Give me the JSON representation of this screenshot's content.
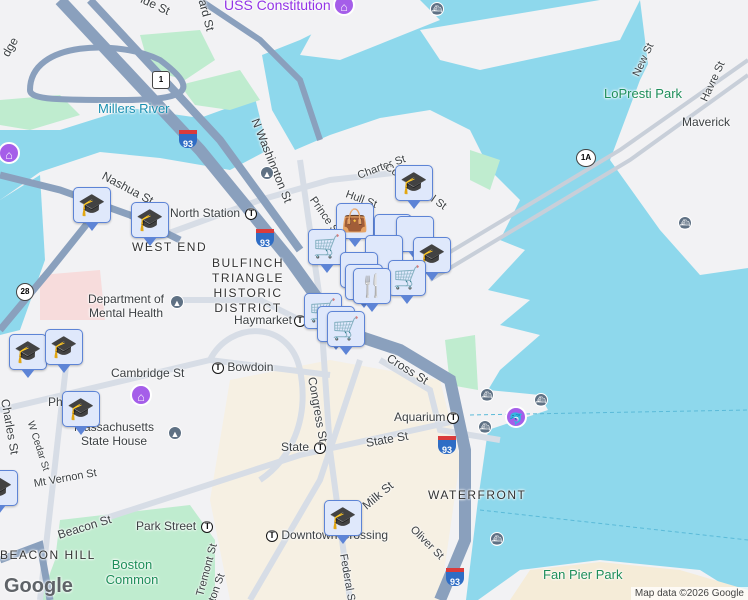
{
  "map": {
    "colors": {
      "water": "#8ed8ec",
      "land": "#f2f2f4",
      "park": "#bfeccf",
      "highway": "#8aa0bd",
      "road": "#d7dde6",
      "marker_bg": "#dfe8fb",
      "marker_border": "#5d84d6",
      "poi": "#9334e6"
    },
    "labels": {
      "uss_constitution": "USS Constitution",
      "millers_river": "Millers River",
      "n_washington_st": "N Washington St",
      "nashua_st": "Nashua St",
      "station": "North Station",
      "west_end": "WEST END",
      "bulfinch": "BULFINCH TRIANGLE HISTORIC DISTRICT",
      "dept_mental_health": "Department of Mental Health",
      "haymarket": "Haymarket",
      "cambridge_st": "Cambridge St",
      "bowdoin": "Bowdoin",
      "charles_st": "Charles St",
      "w_cedar_st": "W Cedar St",
      "ma_state_house": "Massachusetts State House",
      "mt_vernon_st": "Mt Vernon St",
      "beacon_st": "Beacon St",
      "park_street": "Park Street",
      "beacon_hill": "BEACON HILL",
      "boston_common": "Boston Common",
      "congress_st": "Congress St",
      "state": "State",
      "state_st": "State St",
      "downtown_crossing": "Downtown Crossing",
      "federal_st": "Federal St",
      "milk_st": "Milk St",
      "oliver_st": "Oliver St",
      "waterfront": "WATERFRONT",
      "aquarium": "Aquarium",
      "cross_st": "Cross St",
      "fan_pier_park": "Fan Pier Park",
      "lopresti_park": "LoPresti Park",
      "maverick": "Maverick",
      "new_st": "New St",
      "havre_st": "Havre St",
      "charter_st": "Charter St",
      "commercial_st": "Commercial St",
      "hull_st": "Hull St",
      "prince_st": "Prince St",
      "phillips": "Ph",
      "tremont_st": "Tremont St",
      "washington_st": "ton St",
      "bridge": "dge",
      "fed_st": "ward St",
      "ide_st": "ide St"
    },
    "shields": {
      "us1": "1",
      "i93": "93",
      "ma28": "28",
      "ma1a": "1A"
    },
    "attribution": "Map data ©2026 Google",
    "logo": "Google"
  }
}
